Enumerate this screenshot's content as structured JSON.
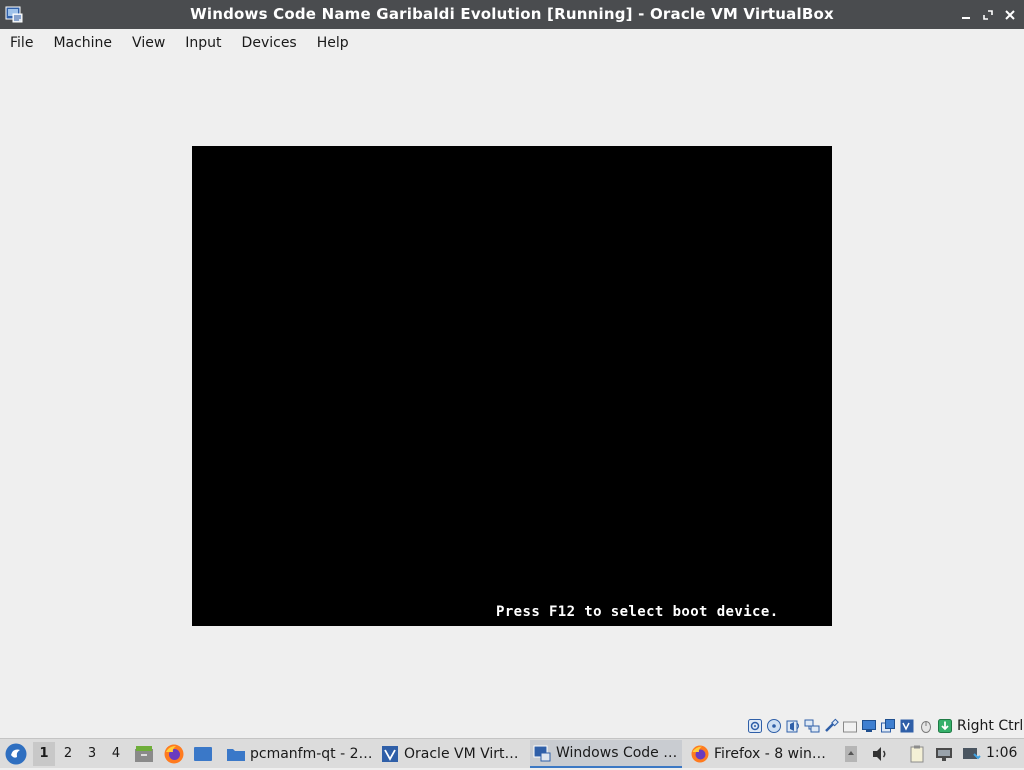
{
  "window": {
    "title": "Windows Code Name Garibaldi Evolution [Running] - Oracle VM VirtualBox",
    "icon": "virtualbox-icon",
    "buttons": [
      "minimize-icon",
      "restore-icon",
      "close-icon"
    ]
  },
  "menubar": {
    "items": [
      "File",
      "Machine",
      "View",
      "Input",
      "Devices",
      "Help"
    ]
  },
  "vm_screen": {
    "background": "#000000",
    "boot_message": "Press F12 to select boot device."
  },
  "statusbar": {
    "icons": [
      "hard-disk-icon",
      "optical-drive-icon",
      "audio-icon",
      "network-icon",
      "usb-icon",
      "shared-folders-icon",
      "display-icon",
      "recording-icon",
      "virtualization-icon",
      "mouse-integration-icon",
      "host-key-icon"
    ],
    "host_key": "Right Ctrl"
  },
  "taskbar": {
    "desktops": [
      "1",
      "2",
      "3",
      "4"
    ],
    "active_desktop": "1",
    "launchers": [
      "file-manager-icon",
      "firefox-icon",
      "desktop-icon"
    ],
    "tasks": [
      {
        "label": "pcmanfm-qt - 2…",
        "icon": "folder-icon"
      },
      {
        "label": "Oracle VM Virt…",
        "icon": "virtualbox-icon"
      },
      {
        "label": "Windows Code …",
        "icon": "virtualbox-icon",
        "active": true
      },
      {
        "label": "Firefox - 8 win…",
        "icon": "firefox-icon"
      }
    ],
    "tray": [
      "scroll-up-icon",
      "volume-icon",
      "clipboard-icon",
      "network-icon",
      "update-icon"
    ],
    "clock": "1:06"
  },
  "colors": {
    "titlebar": "#4a4c4f",
    "window_bg": "#efefef",
    "vm_bg": "#000000",
    "taskbar": "#dcdcdc",
    "accent": "#3b78c4"
  }
}
